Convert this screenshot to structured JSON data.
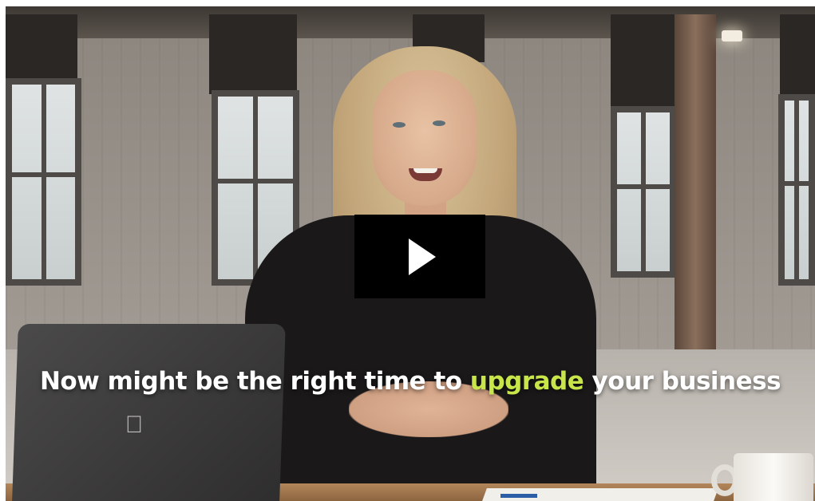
{
  "video": {
    "caption": {
      "before": "Now might be the right time to ",
      "highlight": "upgrade",
      "after": " your business"
    },
    "play_button": {
      "icon": "play-icon",
      "label": ""
    }
  },
  "colors": {
    "caption_text": "#ffffff",
    "caption_highlight": "#c8e64a",
    "play_button_bg": "#000000"
  },
  "scene": {
    "logo_glyph": ""
  }
}
